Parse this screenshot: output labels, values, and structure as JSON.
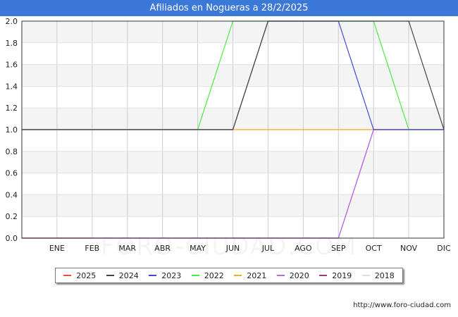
{
  "header": {
    "title": "Afiliados en Nogueras a 28/2/2025"
  },
  "footer": {
    "source": "http://www.foro-ciudad.com"
  },
  "watermark": {
    "text": "FORO-CIUDAD.COM"
  },
  "chart_data": {
    "type": "line",
    "title": "Afiliados en Nogueras a 28/2/2025",
    "categories": [
      "",
      "ENE",
      "FEB",
      "MAR",
      "ABR",
      "MAY",
      "JUN",
      "JUL",
      "AGO",
      "SEP",
      "OCT",
      "NOV",
      "DIC"
    ],
    "ylim": [
      0,
      2.0
    ],
    "yticks": [
      "0.0",
      "0.2",
      "0.4",
      "0.6",
      "0.8",
      "1.0",
      "1.2",
      "1.4",
      "1.6",
      "1.8",
      "2.0"
    ],
    "grid": true,
    "legend_position": "bottom",
    "series": [
      {
        "name": "2025",
        "color": "#ff4444",
        "values": [
          0,
          0,
          0,
          null,
          null,
          null,
          null,
          null,
          null,
          null,
          null,
          null,
          null
        ]
      },
      {
        "name": "2024",
        "color": "#444444",
        "values": [
          1,
          1,
          1,
          1,
          1,
          1,
          1,
          2,
          2,
          2,
          2,
          2,
          1
        ]
      },
      {
        "name": "2023",
        "color": "#4444dd",
        "values": [
          1,
          1,
          1,
          1,
          1,
          1,
          1,
          2,
          2,
          2,
          1,
          1,
          1
        ]
      },
      {
        "name": "2022",
        "color": "#44ee44",
        "values": [
          1,
          1,
          1,
          1,
          1,
          1,
          2,
          2,
          2,
          2,
          2,
          1,
          1
        ]
      },
      {
        "name": "2021",
        "color": "#ffaa22",
        "values": [
          1,
          1,
          1,
          1,
          1,
          1,
          1,
          1,
          1,
          1,
          1,
          1,
          1
        ]
      },
      {
        "name": "2020",
        "color": "#bb66ee",
        "values": [
          0,
          0,
          0,
          0,
          0,
          0,
          0,
          0,
          0,
          0,
          1,
          1,
          1
        ]
      },
      {
        "name": "2019",
        "color": "#aa3388",
        "values": [
          0,
          0,
          0,
          0,
          0,
          0,
          0,
          0,
          0,
          0,
          1,
          1,
          1
        ]
      },
      {
        "name": "2018",
        "color": "#dddddd",
        "values": [
          1,
          1,
          1,
          1,
          1,
          1,
          1,
          1,
          1,
          1,
          1,
          1,
          1
        ]
      }
    ]
  }
}
